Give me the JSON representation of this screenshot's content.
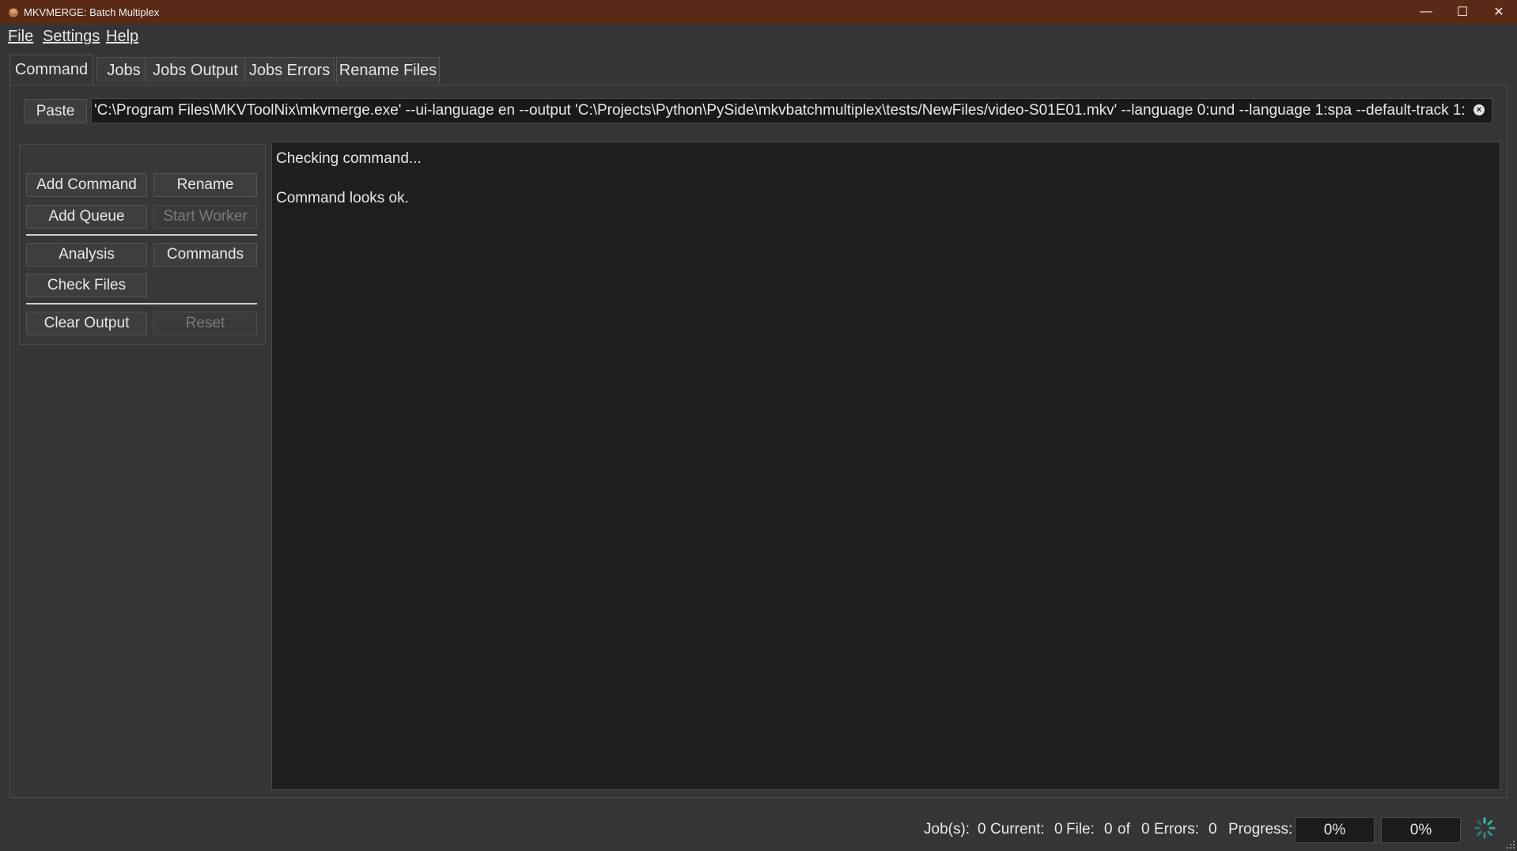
{
  "window": {
    "title": "MKVMERGE: Batch Multiplex",
    "controls": {
      "minimize": "—",
      "maximize": "☐",
      "close": "✕"
    }
  },
  "menu": [
    {
      "label": "File"
    },
    {
      "label": "Settings"
    },
    {
      "label": "Help"
    }
  ],
  "tabs": [
    {
      "label": "Command",
      "active": true
    },
    {
      "label": "Jobs"
    },
    {
      "label": "Jobs Output"
    },
    {
      "label": "Jobs Errors"
    },
    {
      "label": "Rename Files"
    }
  ],
  "command": {
    "paste_label": "Paste",
    "value": "'C:\\Program Files\\MKVToolNix\\mkvmerge.exe' --ui-language en --output 'C:\\Projects\\Python\\PySide\\mkvbatchmultiplex\\tests/NewFiles/video-S01E01.mkv' --language 0:und --language 1:spa --default-track 1:"
  },
  "buttons": {
    "add_command": "Add Command",
    "rename": "Rename",
    "add_queue": "Add Queue",
    "start_worker": "Start Worker",
    "analysis": "Analysis",
    "commands": "Commands",
    "check_files": "Check Files",
    "clear_output": "Clear Output",
    "reset": "Reset"
  },
  "output": {
    "lines": [
      "Checking command...",
      "",
      "Command looks ok."
    ]
  },
  "status": {
    "jobs_label": "Job(s):",
    "jobs_value": "0",
    "current_label": "Current:",
    "current_value": "0",
    "file_label": "File:",
    "file_value": "0",
    "of_label": "of",
    "of_value": "0",
    "errors_label": "Errors:",
    "errors_value": "0",
    "progress_label": "Progress:",
    "progress_1": "0%",
    "progress_2": "0%"
  },
  "colors": {
    "titlebar": "#5b2a17",
    "accent_spinner": "#2ec4b6"
  }
}
